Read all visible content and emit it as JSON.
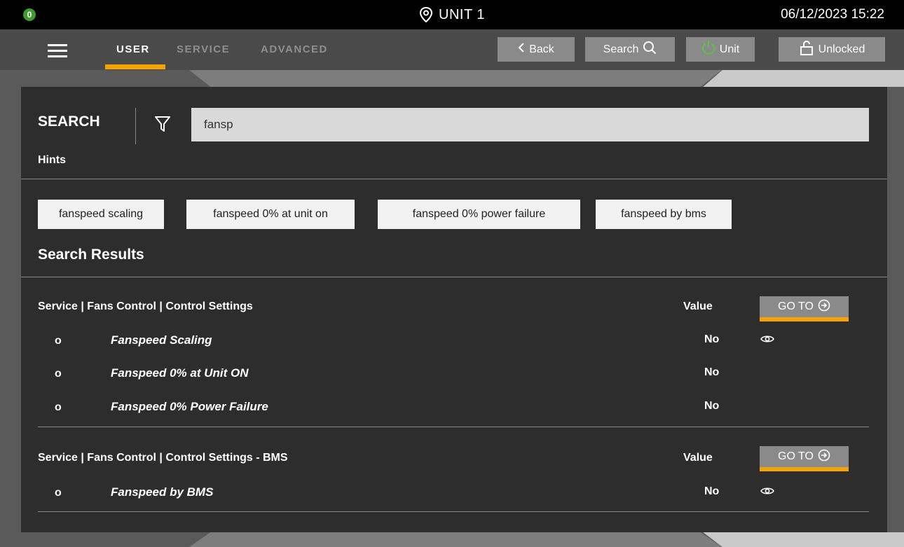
{
  "statusbar": {
    "alarm_count": "0",
    "unit_name": "UNIT 1",
    "datetime": "06/12/2023 15:22"
  },
  "nav": {
    "tabs": [
      {
        "label": "USER",
        "active": true
      },
      {
        "label": "SERVICE",
        "active": false
      },
      {
        "label": "ADVANCED",
        "active": false
      }
    ],
    "back_label": "Back",
    "search_label": "Search",
    "unit_label": "Unit",
    "lock_label": "Unlocked"
  },
  "search": {
    "title": "SEARCH",
    "query": "fansp",
    "hints_label": "Hints",
    "hints": [
      "fanspeed scaling",
      "fanspeed 0% at unit on",
      "fanspeed 0%  power failure",
      "fanspeed by bms"
    ]
  },
  "results": {
    "title": "Search Results",
    "value_header": "Value",
    "goto_label": "GO TO",
    "bullet": "o",
    "groups": [
      {
        "path": "Service | Fans Control | Control Settings",
        "items": [
          {
            "name": "Fanspeed Scaling",
            "value": "No"
          },
          {
            "name": "Fanspeed 0% at Unit ON",
            "value": "No"
          },
          {
            "name": "Fanspeed 0% Power Failure",
            "value": "No"
          }
        ]
      },
      {
        "path": "Service | Fans Control | Control Settings - BMS",
        "items": [
          {
            "name": "Fanspeed by BMS",
            "value": "No"
          }
        ]
      }
    ]
  },
  "colors": {
    "accent": "#f5a300",
    "power_icon": "#5fc043",
    "alarm_badge": "#3f9b2f",
    "panel": "#2d2d2d",
    "button": "#8a8a8a"
  },
  "icons": [
    "location-pin-icon",
    "hamburger-icon",
    "chevron-left-icon",
    "search-icon",
    "power-icon",
    "unlock-icon",
    "filter-icon",
    "arrow-circle-right-icon",
    "eye-icon"
  ]
}
